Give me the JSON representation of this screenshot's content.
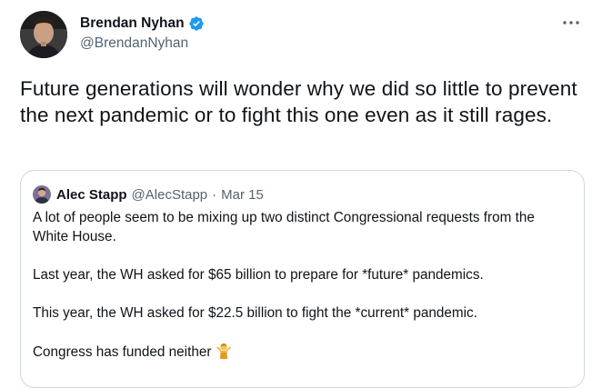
{
  "tweet": {
    "author": {
      "display_name": "Brendan Nyhan",
      "handle": "@BrendanNyhan",
      "verified": true,
      "avatar_icon": "profile-photo"
    },
    "more_icon": "more-horizontal-icon",
    "text": "Future generations will wonder why we did so little to prevent the next pandemic or to fight this one even as it still rages."
  },
  "quoted_tweet": {
    "author": {
      "display_name": "Alec Stapp",
      "handle": "@AlecStapp",
      "separator": "·",
      "date": "Mar 15",
      "avatar_icon": "profile-photo"
    },
    "paragraphs": [
      "A lot of people seem to be mixing up two distinct Congressional requests from the White House.",
      "Last year, the WH asked for $65 billion to prepare for *future* pandemics.",
      "This year, the WH asked for $22.5 billion to fight the *current* pandemic.",
      "Congress has funded neither"
    ],
    "trailing_emoji": "person-shrugging-emoji"
  },
  "colors": {
    "text_primary": "#0f1419",
    "text_secondary": "#536471",
    "verified_blue": "#1d9bf0",
    "border": "#cfd9de"
  }
}
